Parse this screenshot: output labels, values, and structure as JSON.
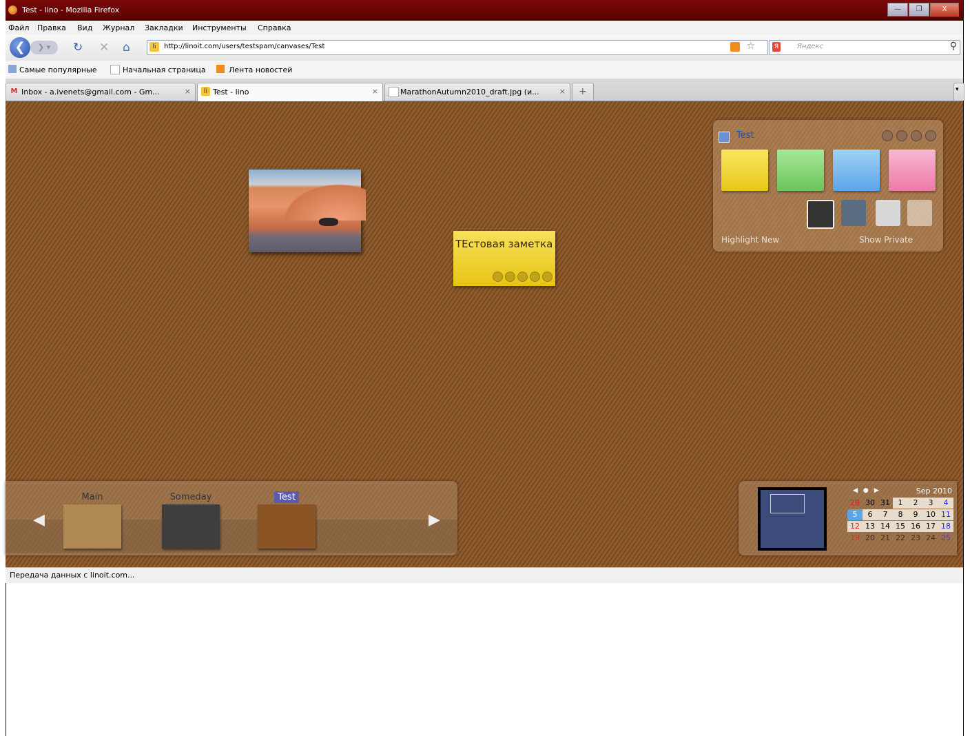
{
  "window": {
    "title": "Test - linо - Mozilla Firefox",
    "buttons": [
      "—",
      "❐",
      "X"
    ]
  },
  "menu": [
    "Файл",
    "Правка",
    "Вид",
    "Журнал",
    "Закладки",
    "Инструменты",
    "Справка"
  ],
  "navbar": {
    "url": "http://linoit.com/users/testspam/canvases/Test",
    "search_placeholder": "Яндекс"
  },
  "bookmarks": [
    "Самые популярные",
    "Начальная страница",
    "Лента новостей"
  ],
  "tabs": [
    {
      "label": "Inbox - a.ivenets@gmail.com - Gm...",
      "active": false
    },
    {
      "label": "Test - lino",
      "active": true
    },
    {
      "label": "MarathonAutumn2010_draft.jpg (и...",
      "active": false
    }
  ],
  "note": {
    "text": "ТЕстовая заметка"
  },
  "panel": {
    "title": "Test",
    "highlight_label": "Highlight New",
    "show_private_label": "Show Private",
    "sticky_colors": [
      "#f1db3c",
      "#8fd880",
      "#7fbef0",
      "#f19bbd"
    ]
  },
  "canvases": [
    {
      "name": "Main",
      "selected": false
    },
    {
      "name": "Someday",
      "selected": false
    },
    {
      "name": "Test",
      "selected": true
    }
  ],
  "calendar": {
    "month": "Sep 2010",
    "rows": [
      [
        "29",
        "30",
        "31",
        "1",
        "2",
        "3",
        "4"
      ],
      [
        "5",
        "6",
        "7",
        "8",
        "9",
        "10",
        "11"
      ],
      [
        "12",
        "13",
        "14",
        "15",
        "16",
        "17",
        "18"
      ],
      [
        "19",
        "20",
        "21",
        "22",
        "23",
        "24",
        "25"
      ]
    ]
  },
  "status": "Передача данных с linoit.com..."
}
